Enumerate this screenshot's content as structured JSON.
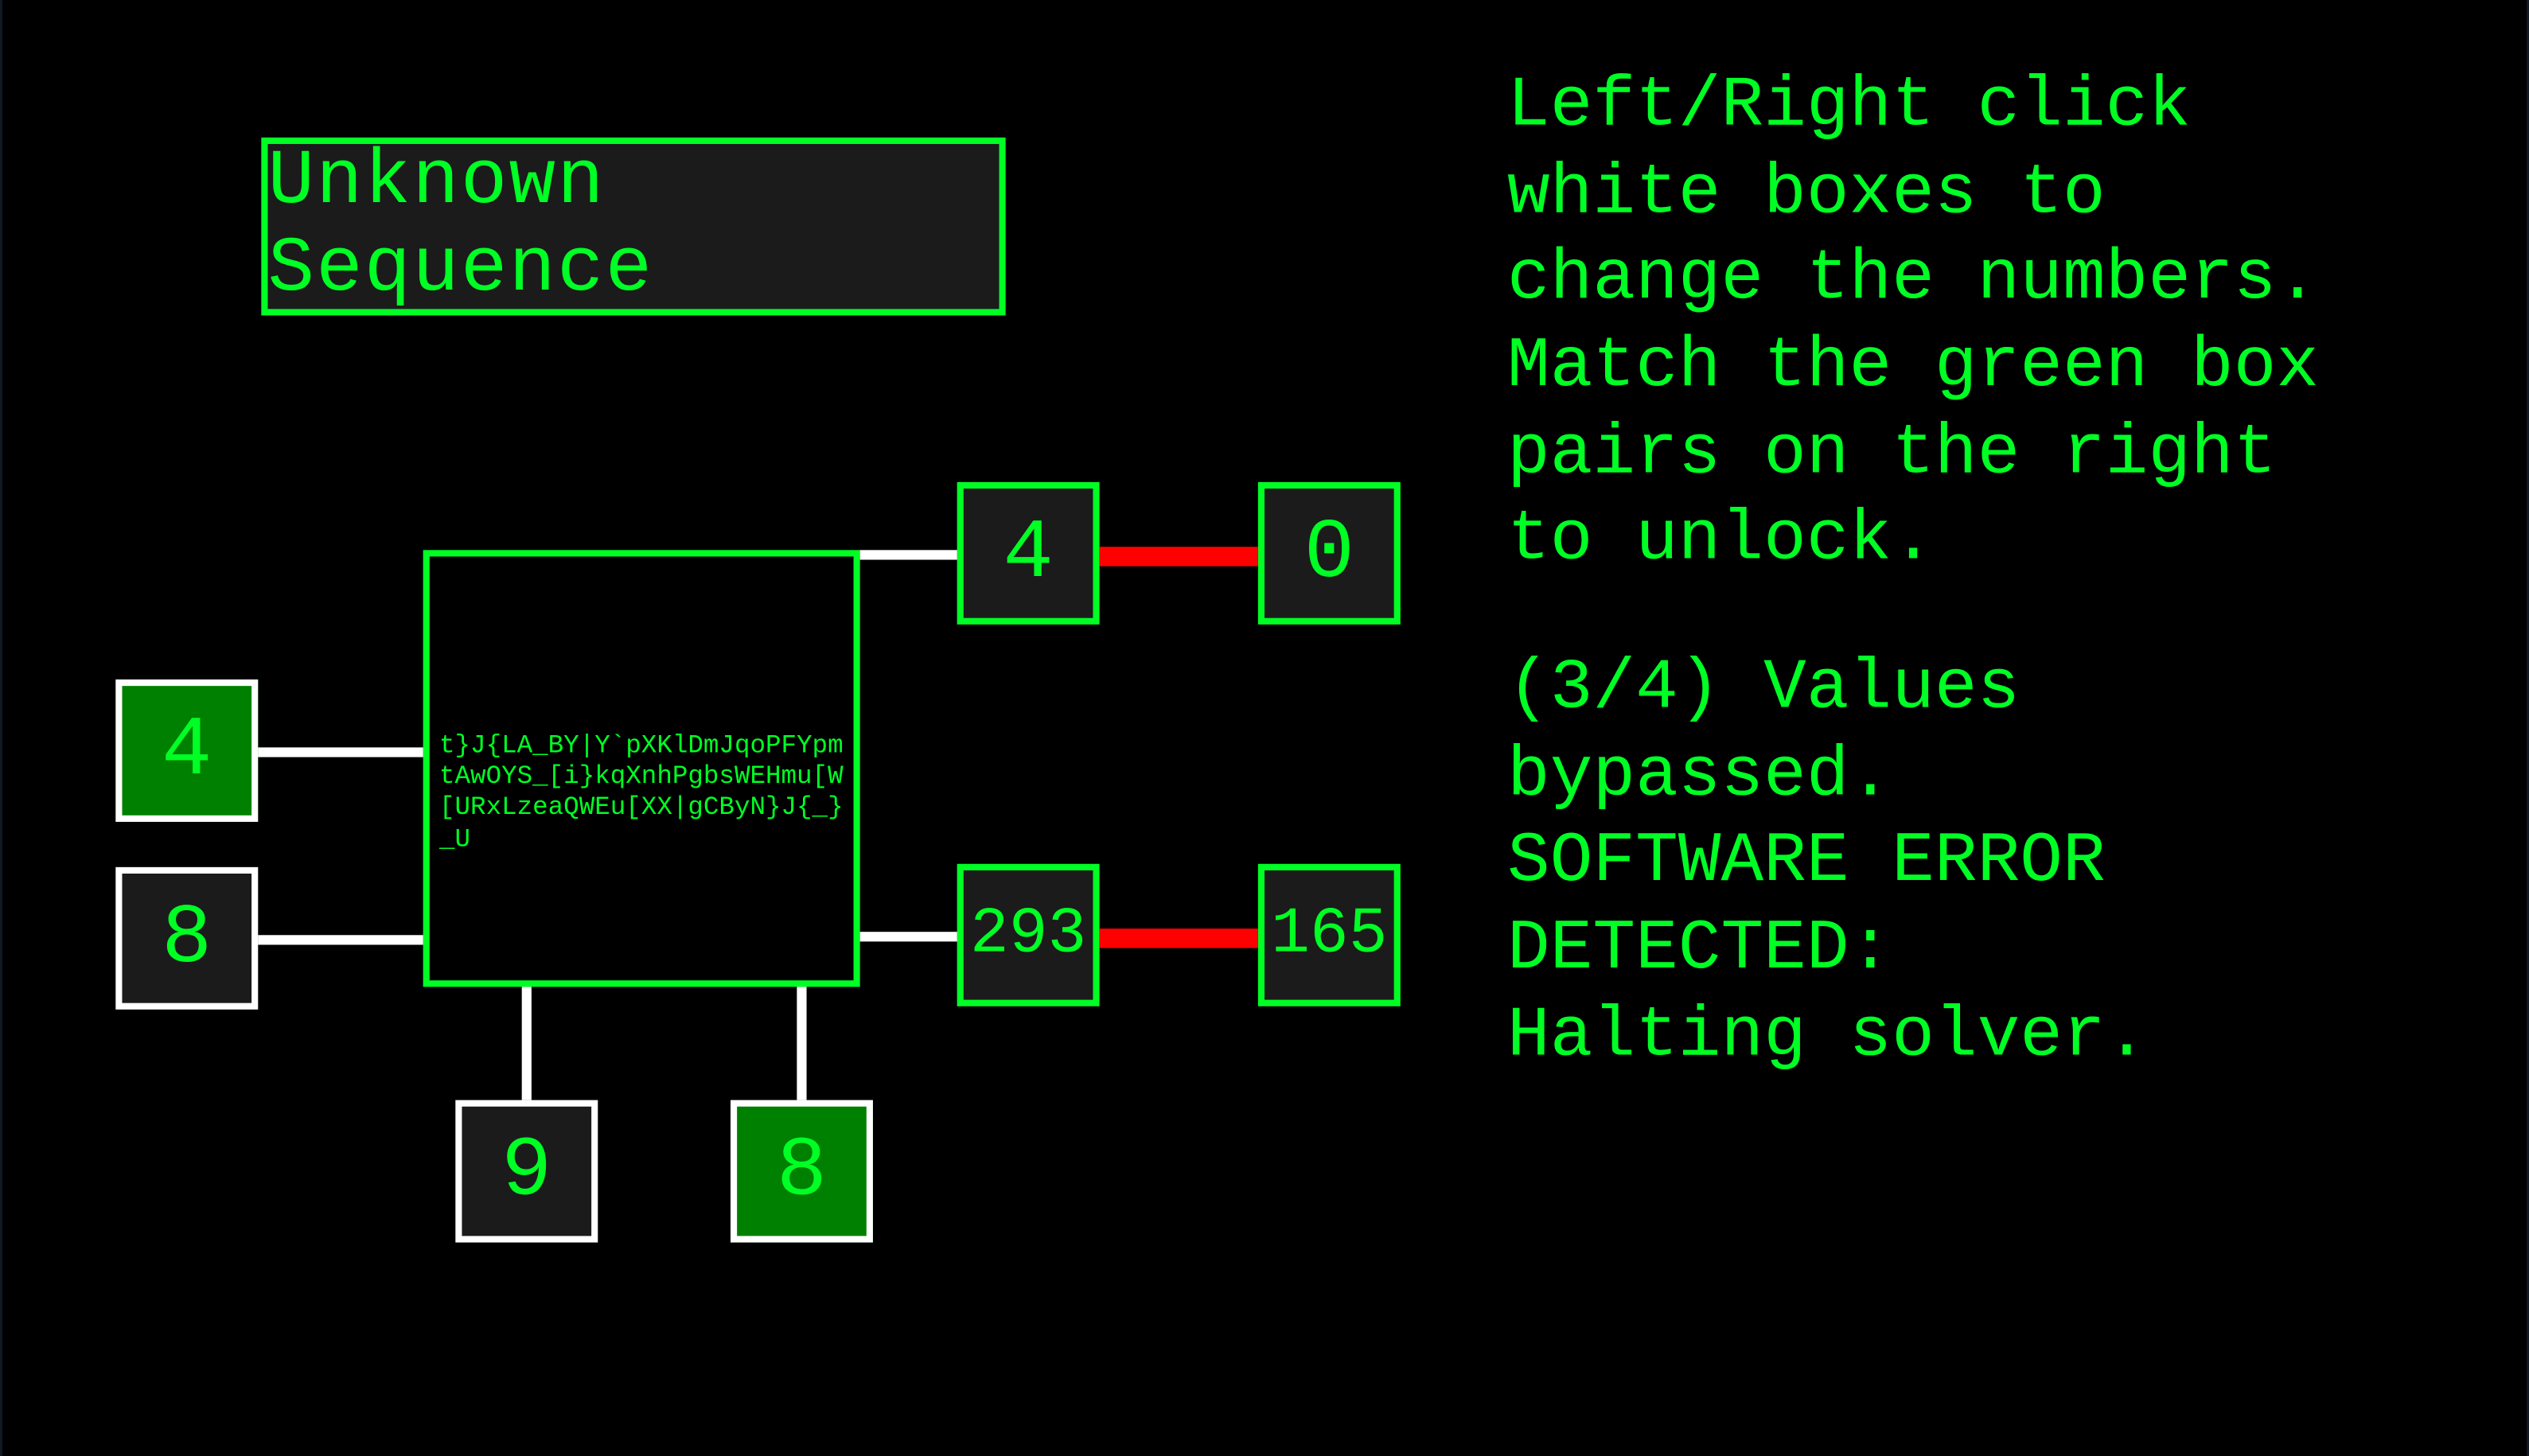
{
  "title": "Unknown Sequence",
  "center_text": "t}J{LA_BY|Y`pXKlDmJqoPFYpmtAwOYS_[i}kqXnhPgbsWEHmu[W[URxLzeaQWEu[XX|gCByN}J{_}_U",
  "inputs": {
    "left_top": "4",
    "left_bottom": "8",
    "bottom_left": "9",
    "bottom_right": "8"
  },
  "outputs": {
    "top_left": "4",
    "top_right": "0",
    "bottom_left": "293",
    "bottom_right": "165"
  },
  "instructions_text": "Left/Right click\nwhite boxes to\nchange the numbers.\nMatch the green box\npairs on the right\nto unlock.",
  "status_text": "(3/4) Values\nbypassed.\nSOFTWARE ERROR\nDETECTED:\nHalting solver.",
  "colors": {
    "accent": "#00ff24",
    "wire_bad": "#ff0000",
    "wire_good": "#ffffff",
    "bg": "#000000"
  }
}
